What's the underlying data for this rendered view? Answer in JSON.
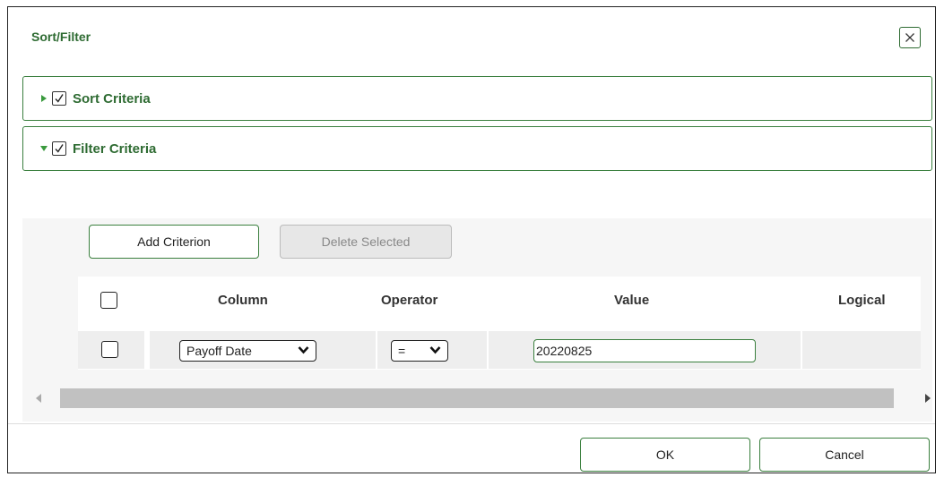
{
  "dialog": {
    "title": "Sort/Filter",
    "close_label": "X"
  },
  "sections": {
    "sort": {
      "label": "Sort Criteria",
      "checked": true,
      "expanded": false
    },
    "filter": {
      "label": "Filter Criteria",
      "checked": true,
      "expanded": true
    }
  },
  "toolbar": {
    "add_label": "Add Criterion",
    "delete_label": "Delete Selected"
  },
  "table": {
    "columns": [
      "Column",
      "Operator",
      "Value",
      "Logical"
    ],
    "rows": [
      {
        "column": "Payoff Date",
        "operator": "=",
        "value": "20220825",
        "logical": ""
      }
    ]
  },
  "footer": {
    "ok_label": "OK",
    "cancel_label": "Cancel"
  },
  "colors": {
    "accent_green": "#2e6b32",
    "border_green": "#3a7f3e"
  }
}
